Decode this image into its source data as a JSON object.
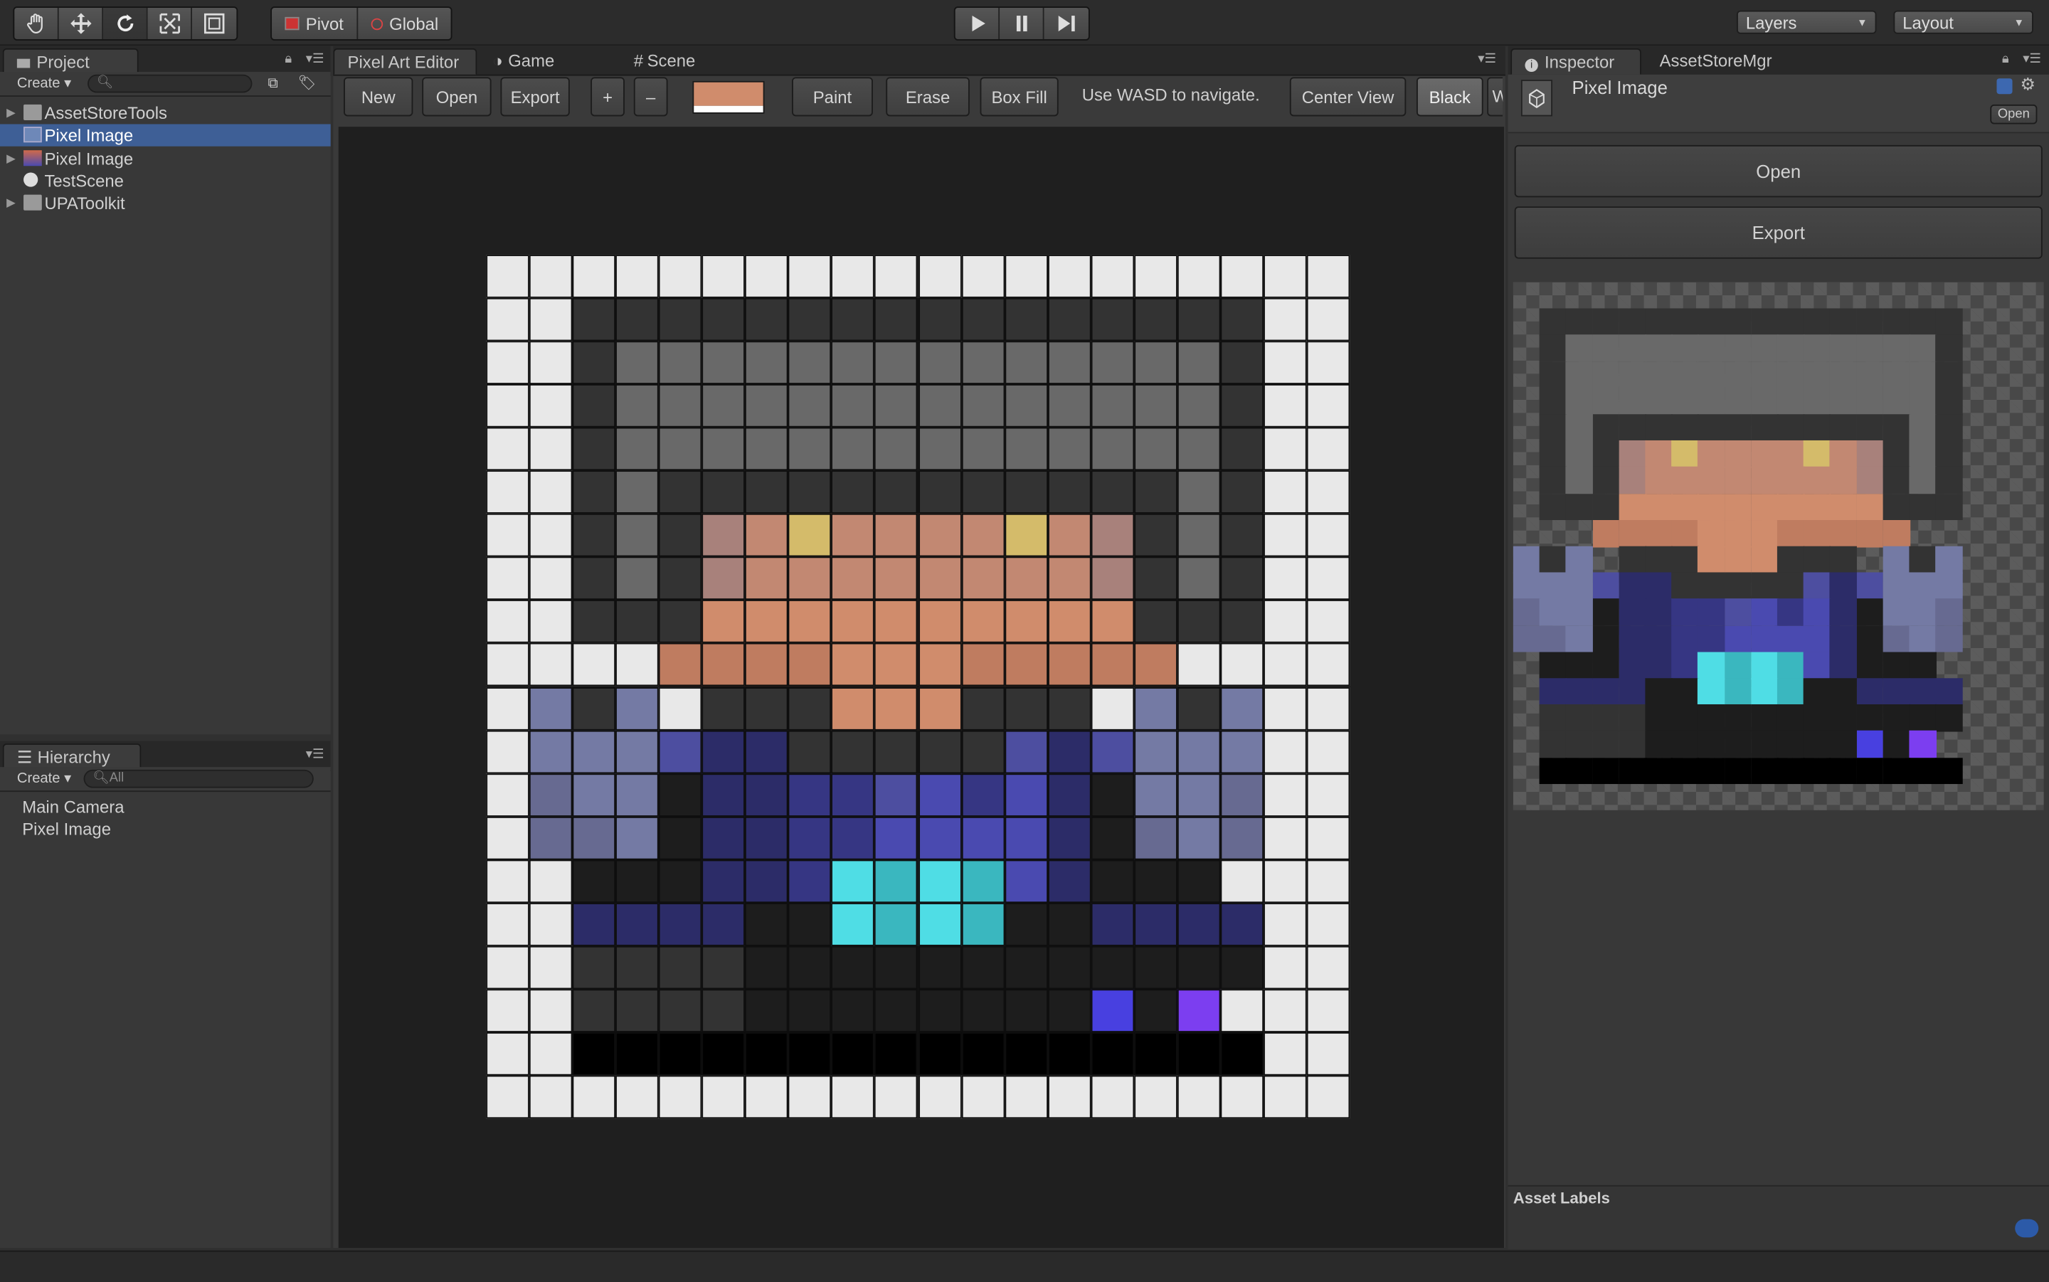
{
  "toolbar": {
    "tools": [
      "hand-icon",
      "move-icon",
      "rotate-icon",
      "scale-icon",
      "rect-icon"
    ],
    "pivot": "Pivot",
    "global": "Global",
    "layers": "Layers",
    "layout": "Layout"
  },
  "project": {
    "tab": "Project",
    "create": "Create",
    "items": [
      {
        "label": "AssetStoreTools",
        "icon": "folder-icon",
        "expandable": true,
        "selected": false
      },
      {
        "label": "Pixel Image",
        "icon": "pixel-image-asset-icon",
        "expandable": false,
        "selected": true
      },
      {
        "label": "Pixel Image",
        "icon": "texture-icon",
        "expandable": true,
        "selected": false
      },
      {
        "label": "TestScene",
        "icon": "unity-scene-icon",
        "expandable": false,
        "selected": false
      },
      {
        "label": "UPAToolkit",
        "icon": "folder-icon",
        "expandable": true,
        "selected": false
      }
    ]
  },
  "hierarchy": {
    "tab": "Hierarchy",
    "create": "Create",
    "search_placeholder": "All",
    "items": [
      "Main Camera",
      "Pixel Image"
    ]
  },
  "editor": {
    "tabs": [
      "Pixel Art Editor",
      "Game",
      "Scene"
    ],
    "buttons": {
      "new": "New",
      "open": "Open",
      "export": "Export",
      "zoom_in": "+",
      "zoom_out": "–",
      "paint": "Paint",
      "erase": "Erase",
      "box_fill": "Box Fill",
      "center_view": "Center View",
      "black": "Black",
      "white_partial": "W"
    },
    "hint": "Use WASD to navigate.",
    "current_color": "#d08c6c"
  },
  "inspector": {
    "tabs": [
      "Inspector",
      "AssetStoreMgr"
    ],
    "asset_name": "Pixel Image",
    "open_small": "Open",
    "open": "Open",
    "export": "Export",
    "asset_labels": "Asset Labels"
  },
  "pixel_art": {
    "palette": {
      "W": "#e8e8e8",
      "K": "#000000",
      "D": "#333333",
      "G": "#696969",
      "Y": "#d4bb6a",
      "P": "#a8817b",
      "Q": "#c28872",
      "O": "#d08c6c",
      "R": "#bf7c60",
      "L": "#747aa4",
      "M": "#676a91",
      "S": "#4d4ea0",
      "N": "#2c2c68",
      "B": "#363683",
      "V": "#4a4ab0",
      "C": "#4fdde5",
      "T": "#3ab7bf",
      "X": "#1d1d1d",
      "U": "#4840e0",
      "Z": "#7c3ef0"
    },
    "rows": [
      "WWWWWWWWWWWWWWWWWWWW",
      "WWDDDDDDDDDDDDDDDDWW",
      "WWDGGGGGGGGGGGGGGDWW",
      "WWDGGGGGGGGGGGGGGDWW",
      "WWDGGGGGGGGGGGGGGDWW",
      "WWDGDDDDDDDDDDDDGDWW",
      "WWDGDPQYQQQQYQPDGDWW",
      "WWDGDPQQQQQQQQPDGDWW",
      "WWDDDOOOOOOOOOODDDWW",
      "WWWWRRRROOORRRRRWWWW",
      "WLDLWDDDOOODDDWLDLWW",
      "WLLLSNNDDDDDSNSLLLWW",
      "WMLLXNNBBSVBVNXLLMWW",
      "WMMLXNNBBVVVVNXMLMWW",
      "WWXXXNNBCTCTVNXXXWWW",
      "WWNNNNXXCTCTXXNNNNWW",
      "WWDDDDXXXXXXXXXXXXWW",
      "WWDDDDXXXXXXXXUXZWWW",
      "WWKKKKKKKKKKKKKKKKWW",
      "WWWWWWWWWWWWWWWWWWWW"
    ]
  }
}
